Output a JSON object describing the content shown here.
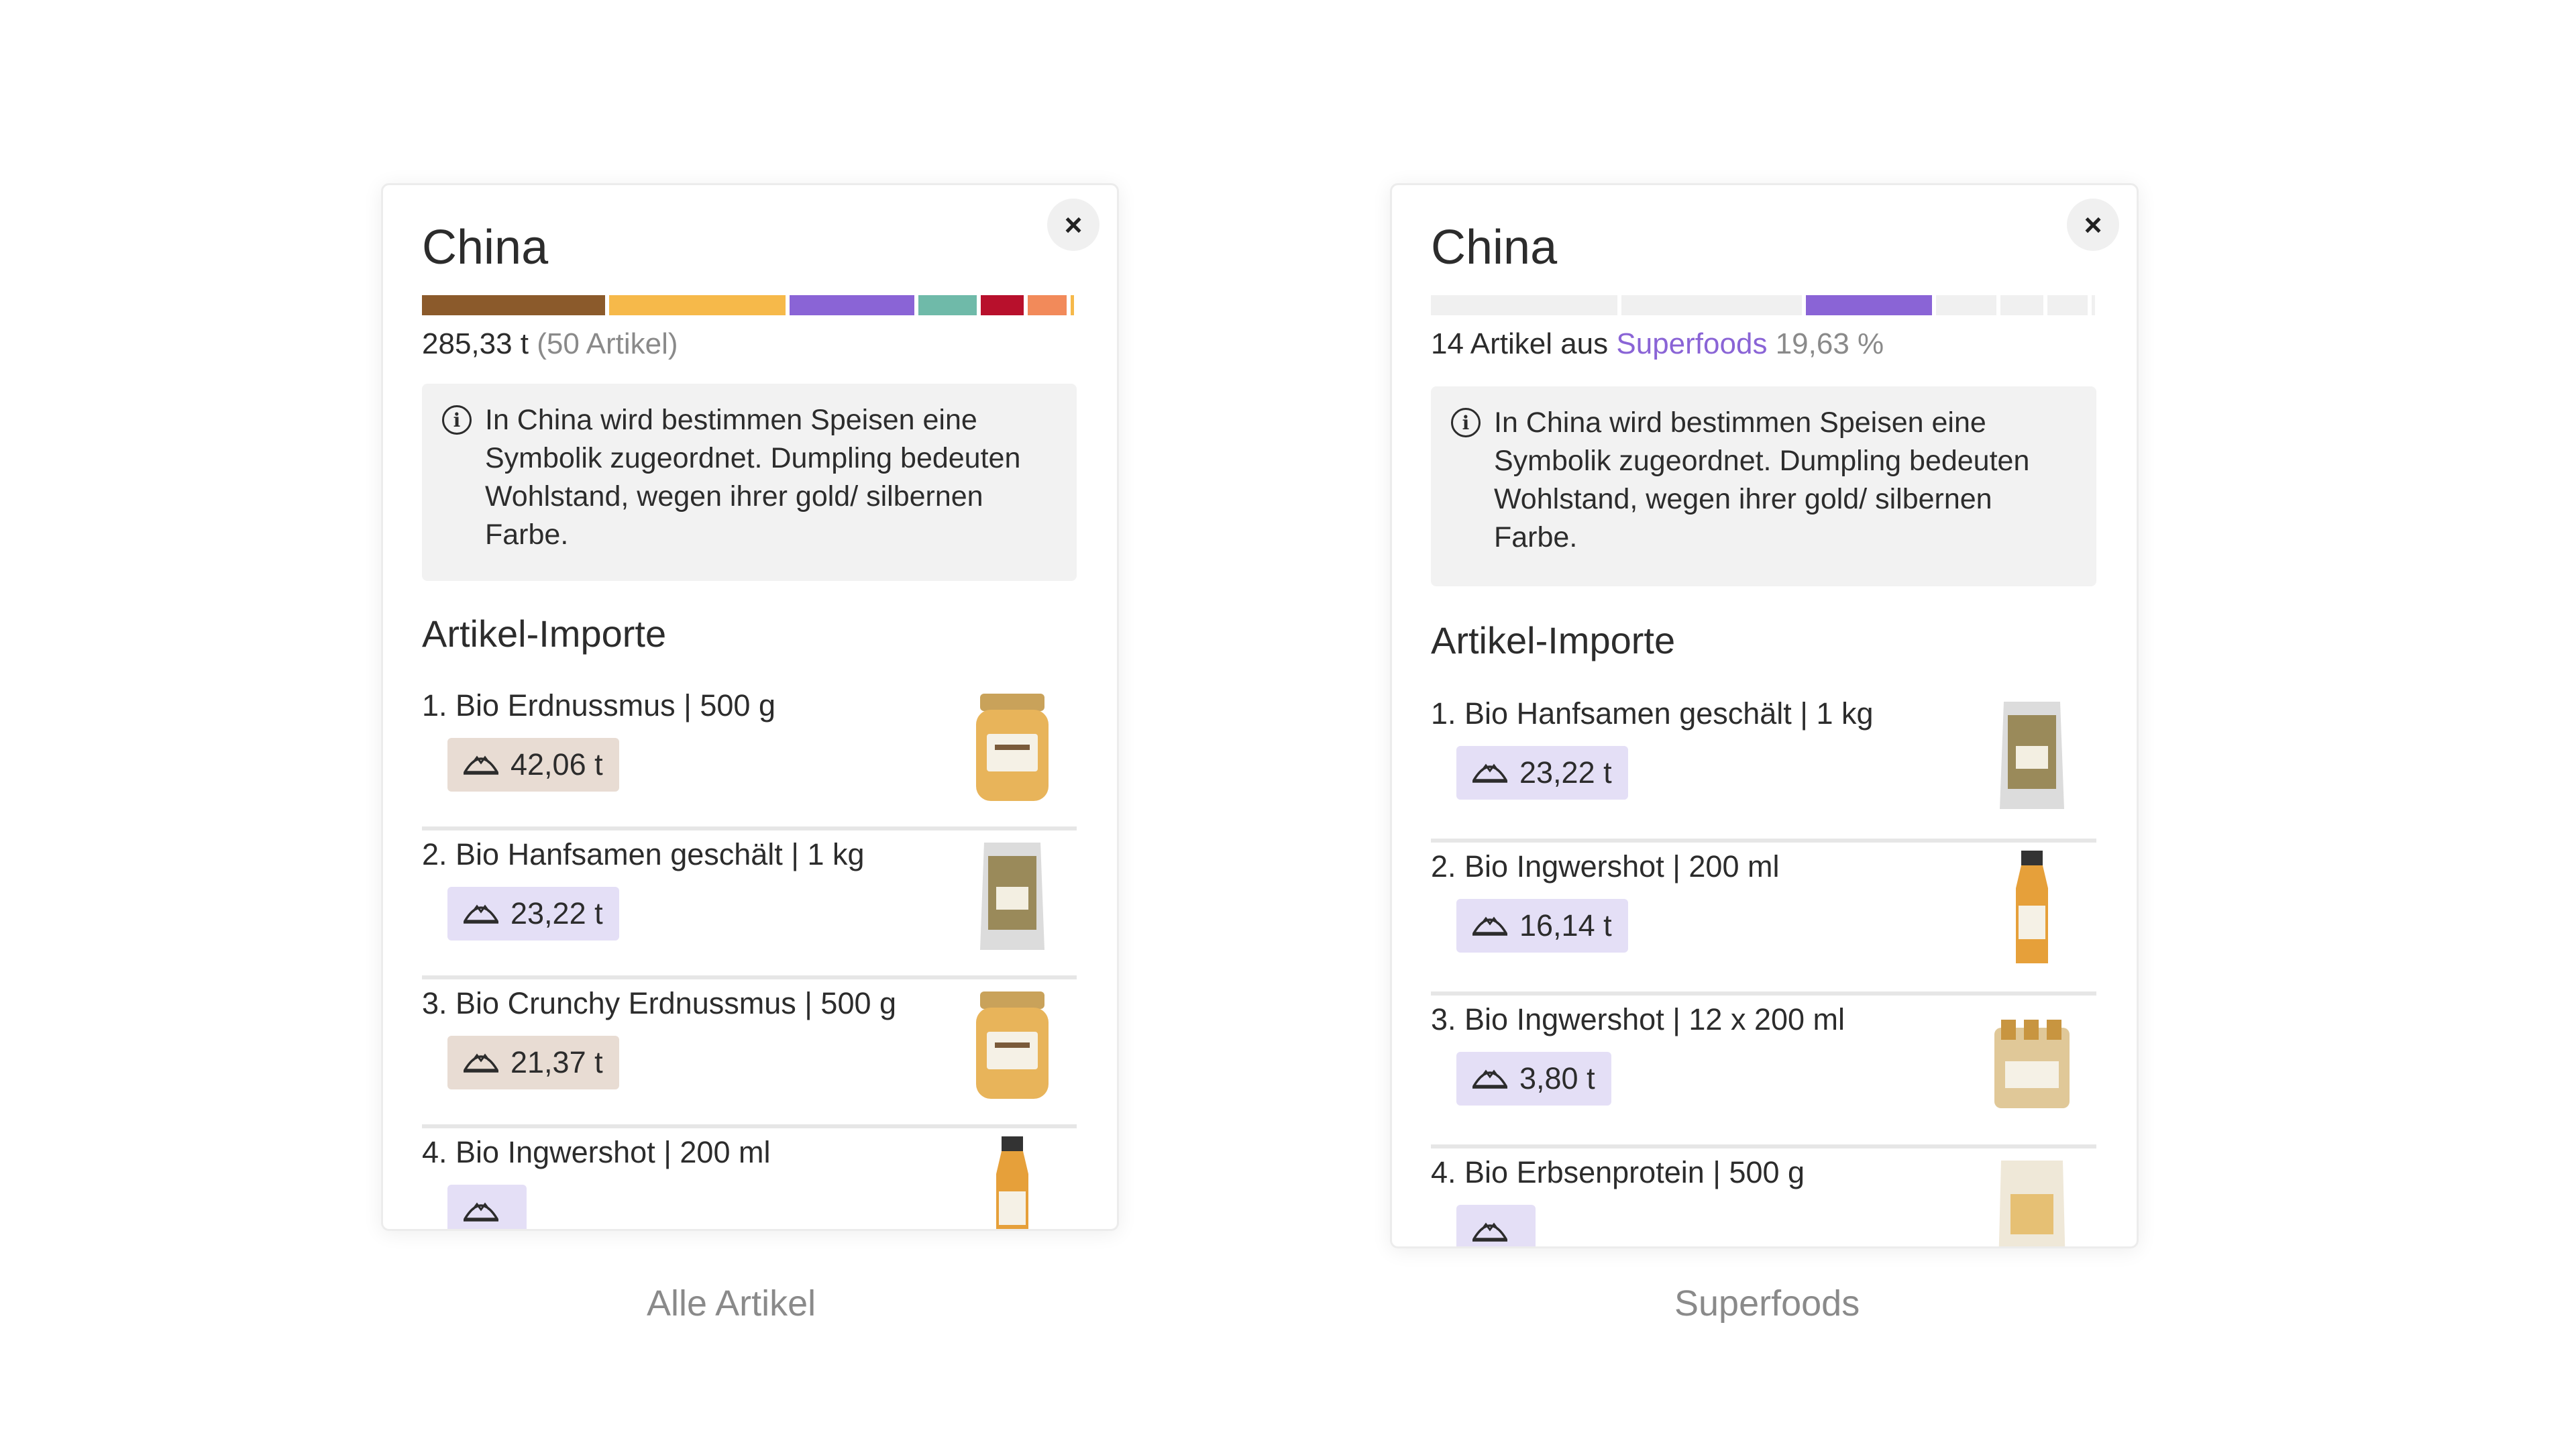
{
  "panels": {
    "left": {
      "title": "China",
      "bar_colors": [
        "#8b5a2b",
        "#f6b94a",
        "#8a64d6",
        "#6fbaa9",
        "#b8102c",
        "#f28a5a",
        "#f6b94a"
      ],
      "bar_fractions": [
        0.28,
        0.27,
        0.19,
        0.09,
        0.065,
        0.06,
        0.005
      ],
      "stat": {
        "value": "285,33 t",
        "count": "(50 Artikel)"
      },
      "info_text": "In China wird bestimmen Speisen eine Symbolik zugeordnet. Dumpling bedeuten Wohlstand, wegen ihrer gold/ silbernen Farbe.",
      "section_title": "Artikel-Importe",
      "items": [
        {
          "label": "1. Bio Erdnussmus | 500 g",
          "amount": "42,06 t",
          "badge": "brown",
          "product": "jar"
        },
        {
          "label": "2. Bio Hanfsamen geschält | 1 kg",
          "amount": "23,22 t",
          "badge": "purple",
          "product": "bag"
        },
        {
          "label": "3. Bio Crunchy Erdnussmus | 500 g",
          "amount": "21,37 t",
          "badge": "brown",
          "product": "jar"
        },
        {
          "label": "4. Bio Ingwershot | 200 ml",
          "amount": "",
          "badge": "purple",
          "product": "bottle"
        }
      ],
      "caption": "Alle Artikel"
    },
    "right": {
      "title": "China",
      "bar_colors": [
        "#f0f0f0",
        "#f0f0f0",
        "#8a64d6",
        "#f0f0f0",
        "#f0f0f0",
        "#f0f0f0",
        "#f0f0f0"
      ],
      "bar_fractions": [
        0.28,
        0.27,
        0.19,
        0.09,
        0.065,
        0.06,
        0.005
      ],
      "stat": {
        "count_text": "14 Artikel aus",
        "category": "Superfoods",
        "percent": "19,63 %"
      },
      "info_text": "In China wird bestimmen Speisen eine Symbolik zugeordnet. Dumpling bedeuten Wohlstand, wegen ihrer gold/ silbernen Farbe.",
      "section_title": "Artikel-Importe",
      "items": [
        {
          "label": "1. Bio Hanfsamen geschält | 1 kg",
          "amount": "23,22 t",
          "badge": "purple",
          "product": "bag"
        },
        {
          "label": "2. Bio Ingwershot | 200 ml",
          "amount": "16,14 t",
          "badge": "purple",
          "product": "bottle"
        },
        {
          "label": "3. Bio Ingwershot | 12 x 200 ml",
          "amount": "3,80 t",
          "badge": "purple",
          "product": "pack"
        },
        {
          "label": "4. Bio Erbsenprotein | 500 g",
          "amount": "",
          "badge": "purple",
          "product": "powder"
        }
      ],
      "caption": "Superfoods"
    }
  },
  "icons": {
    "close": "close-icon",
    "info": "info-icon",
    "dumpling": "dumpling-icon"
  }
}
